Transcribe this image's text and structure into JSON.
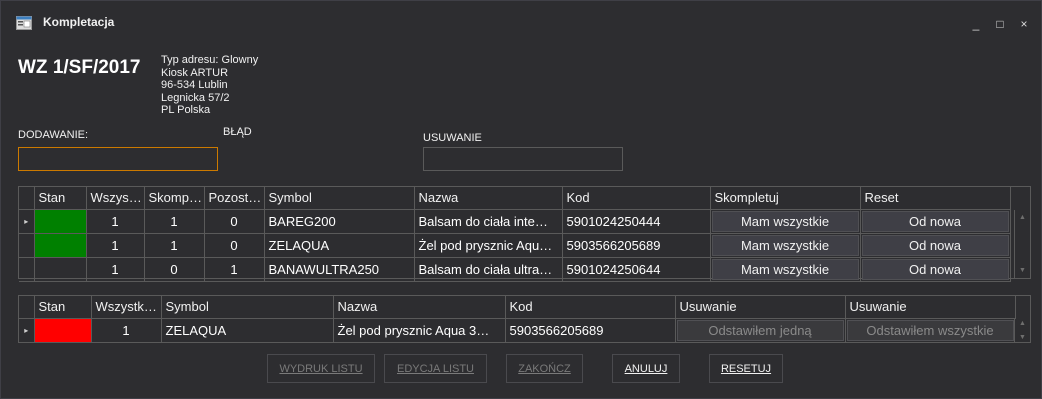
{
  "window": {
    "title": "Kompletacja",
    "icon": "window-form-icon",
    "controls": {
      "minimize": "_",
      "maximize": "□",
      "close": "×"
    }
  },
  "document": {
    "number": "WZ 1/SF/2017",
    "address_lines": [
      "Typ adresu: Glowny",
      "Kiosk ARTUR",
      "96-534 Lublin",
      "Legnicka 57/2",
      "PL Polska"
    ]
  },
  "fields": {
    "add_label": "DODAWANIE:",
    "add_value": "",
    "error_label": "BŁĄD",
    "remove_label": "USUWANIE",
    "remove_value": ""
  },
  "grid1": {
    "headers": [
      "Stan",
      "Wszys…",
      "Skomp…",
      "Pozost…",
      "Symbol",
      "Nazwa",
      "Kod",
      "Skompletuj",
      "Reset"
    ],
    "rows": [
      {
        "indicator": "▸",
        "status": "green",
        "total": "1",
        "completed": "1",
        "remaining": "0",
        "symbol": "BAREG200",
        "name": "Balsam do ciała inte…",
        "code": "5901024250444",
        "complete_btn": "Mam wszystkie",
        "reset_btn": "Od nowa"
      },
      {
        "indicator": "",
        "status": "green",
        "total": "1",
        "completed": "1",
        "remaining": "0",
        "symbol": "ZELAQUA",
        "name": "Żel pod prysznic Aqu…",
        "code": "5903566205689",
        "complete_btn": "Mam wszystkie",
        "reset_btn": "Od nowa"
      },
      {
        "indicator": "",
        "status": "none",
        "total": "1",
        "completed": "0",
        "remaining": "1",
        "symbol": "BANAWULTRA250",
        "name": "Balsam do ciała ultra…",
        "code": "5901024250644",
        "complete_btn": "Mam wszystkie",
        "reset_btn": "Od nowa"
      }
    ]
  },
  "grid2": {
    "headers": [
      "Stan",
      "Wszystk…",
      "Symbol",
      "Nazwa",
      "Kod",
      "Usuwanie",
      "Usuwanie"
    ],
    "rows": [
      {
        "indicator": "▸",
        "status": "red",
        "total": "1",
        "symbol": "ZELAQUA",
        "name": "Żel pod prysznic Aqua 3…",
        "code": "5903566205689",
        "remove_one_btn": "Odstawiłem jedną",
        "remove_all_btn": "Odstawiłem wszystkie"
      }
    ]
  },
  "buttons": {
    "print_list": "WYDRUK LISTU",
    "edit_list": "EDYCJA LISTU",
    "finish": "ZAKOŃCZ",
    "cancel": "ANULUJ",
    "reset": "RESETUJ"
  },
  "colors": {
    "background": "#2d2d30",
    "status_green": "#008000",
    "status_red": "#ff0000",
    "active_input_border": "#cc7a00"
  }
}
